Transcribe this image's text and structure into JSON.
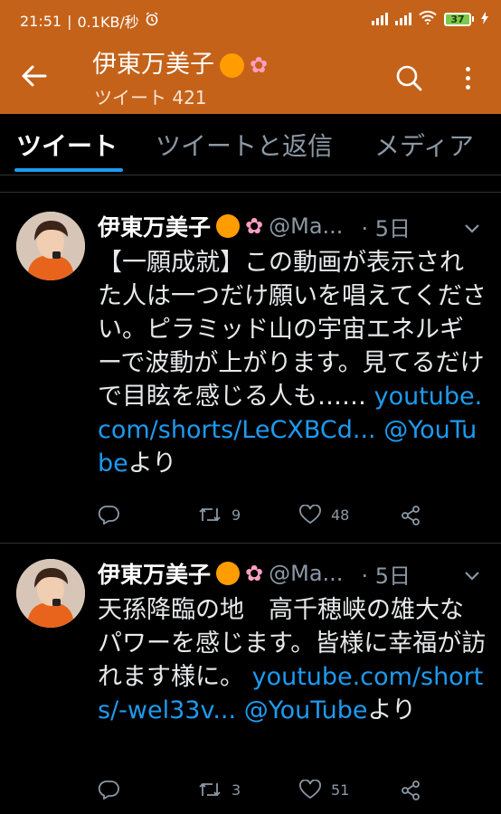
{
  "status_bar": {
    "time": "21:51",
    "speed": "0.1KB/秒",
    "battery": "37"
  },
  "header": {
    "title": "伊東万美子",
    "subtitle": "ツイート 421"
  },
  "tabs": [
    {
      "label": "ツイート"
    },
    {
      "label": "ツイートと返信"
    },
    {
      "label": "メディア"
    }
  ],
  "tweets": [
    {
      "name": "伊東万美子",
      "handle": "@Ma...",
      "time": "· 5日",
      "text": "【一願成就】この動画が表示された人は一つだけ願いを唱えてください。ピラミッド山の宇宙エネルギーで波動が上がります。見てるだけで目眩を感じる人も……",
      "link1": "youtube.com/shorts/LeCXBCd...",
      "link2": "@YouTube",
      "suffix": "より",
      "retweets": "9",
      "likes": "48"
    },
    {
      "name": "伊東万美子",
      "handle": "@Ma...",
      "time": "· 5日",
      "text": "天孫降臨の地　高千穂峡の雄大なパワーを感じます。皆様に幸福が訪れます様に。",
      "link1": "youtube.com/shorts/-wel33v...",
      "link2": "@YouTube",
      "suffix": "より",
      "retweets": "3",
      "likes": "51"
    }
  ],
  "icons": {
    "back": "arrow-left-icon",
    "search": "search-icon",
    "more": "more-vertical-icon",
    "reply": "reply-icon",
    "retweet": "retweet-icon",
    "like": "heart-icon",
    "share": "share-icon"
  },
  "colors": {
    "header_bg": "#c4621a",
    "accent": "#1d9bf0",
    "background": "#000000"
  }
}
